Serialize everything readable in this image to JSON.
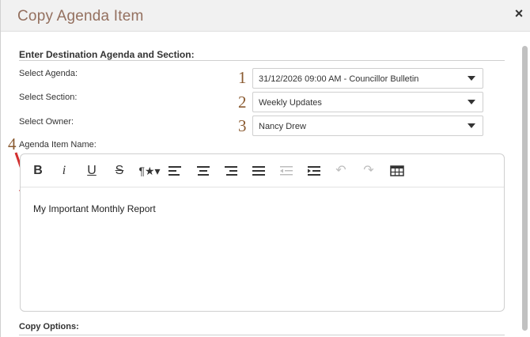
{
  "dialog": {
    "title": "Copy Agenda Item",
    "close_glyph": "×"
  },
  "form": {
    "section_heading": "Enter Destination Agenda and Section:",
    "agenda_label": "Select Agenda:",
    "agenda_value": "31/12/2026 09:00 AM - Councillor Bulletin",
    "section_label": "Select Section:",
    "section_value": "Weekly Updates",
    "owner_label": "Select Owner:",
    "owner_value": "Nancy Drew",
    "item_name_label": "Agenda Item Name:"
  },
  "annotations": {
    "n1": "1",
    "n2": "2",
    "n3": "3",
    "n4": "4",
    "arrow_color": "#d32f2f"
  },
  "editor": {
    "content": "My Important Monthly Report",
    "toolbar_icons": [
      "bold-icon",
      "italic-icon",
      "underline-icon",
      "strikethrough-icon",
      "paragraph-format-icon",
      "align-left-icon",
      "align-center-icon",
      "align-right-icon",
      "align-justify-icon",
      "outdent-icon",
      "indent-icon",
      "undo-icon",
      "redo-icon",
      "table-icon"
    ]
  },
  "options": {
    "heading": "Copy Options:"
  },
  "colors": {
    "title": "#94705f",
    "annotation_number": "#8a5a30"
  }
}
